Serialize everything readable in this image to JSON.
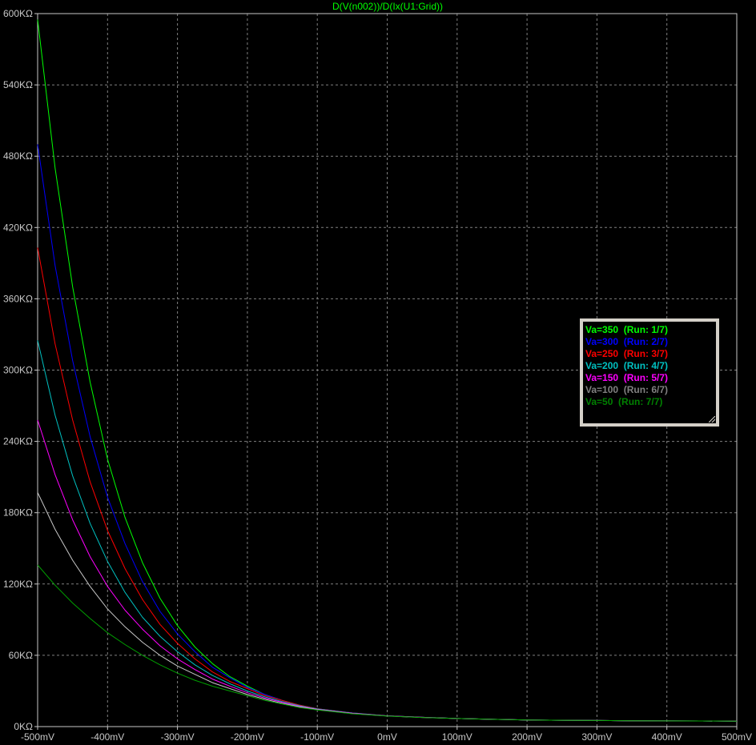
{
  "chart_data": {
    "type": "line",
    "title": "D(V(n002))/D(Ix(U1:Grid))",
    "title_color": "#00ff00",
    "xlabel": "",
    "ylabel": "",
    "x_ticks": [
      "-500mV",
      "-400mV",
      "-300mV",
      "-200mV",
      "-100mV",
      "0mV",
      "100mV",
      "200mV",
      "300mV",
      "400mV",
      "500mV"
    ],
    "y_ticks": [
      "0KΩ",
      "60KΩ",
      "120KΩ",
      "180KΩ",
      "240KΩ",
      "300KΩ",
      "360KΩ",
      "420KΩ",
      "480KΩ",
      "540KΩ",
      "600KΩ"
    ],
    "xlim": [
      -500,
      500
    ],
    "ylim": [
      0,
      600
    ],
    "x_unit": "mV",
    "y_unit": "KΩ",
    "grid": true,
    "legend_placement": "right",
    "x": [
      -500,
      -475,
      -450,
      -425,
      -400,
      -375,
      -350,
      -325,
      -300,
      -275,
      -250,
      -225,
      -200,
      -175,
      -150,
      -125,
      -100,
      -50,
      0,
      50,
      100,
      150,
      200,
      250,
      300,
      350,
      400,
      450,
      500
    ],
    "series": [
      {
        "name": "Va=350",
        "run": "(Run: 1/7)",
        "color": "#00ff00",
        "values": [
          595,
          470,
          370,
          290,
          225,
          176,
          138,
          108,
          85,
          67,
          53,
          42,
          34,
          27,
          22,
          18,
          15,
          11.5,
          9,
          7.8,
          6.8,
          6.1,
          5.6,
          5.3,
          5.1,
          4.9,
          4.8,
          4.7,
          4.6
        ]
      },
      {
        "name": "Va=300",
        "run": "(Run: 2/7)",
        "color": "#0000ff",
        "values": [
          490,
          388,
          308,
          244,
          193,
          154,
          122,
          97,
          78,
          63,
          50,
          41,
          33,
          27,
          22,
          18,
          15,
          11.5,
          9,
          7.8,
          6.8,
          6.1,
          5.6,
          5.3,
          5.1,
          4.9,
          4.8,
          4.7,
          4.6
        ]
      },
      {
        "name": "Va=250",
        "run": "(Run: 3/7)",
        "color": "#ff0000",
        "values": [
          403,
          322,
          258,
          206,
          165,
          133,
          107,
          86,
          70,
          57,
          46,
          38,
          32,
          26,
          22,
          18,
          15,
          11.4,
          9,
          7.8,
          6.8,
          6.1,
          5.6,
          5.3,
          5.1,
          4.9,
          4.8,
          4.7,
          4.6
        ]
      },
      {
        "name": "Va=200",
        "run": "(Run: 4/7)",
        "color": "#00c0c0",
        "values": [
          325,
          262,
          211,
          171,
          139,
          113,
          92,
          76,
          63,
          52,
          43,
          36,
          30,
          25,
          21,
          17.5,
          14.8,
          11.3,
          9,
          7.8,
          6.8,
          6.1,
          5.6,
          5.3,
          5.1,
          4.9,
          4.8,
          4.7,
          4.6
        ]
      },
      {
        "name": "Va=150",
        "run": "(Run: 5/7)",
        "color": "#ff00ff",
        "values": [
          258,
          212,
          174,
          143,
          118,
          98,
          82,
          68,
          57,
          48,
          40,
          34,
          28.5,
          24,
          20.5,
          17,
          14.5,
          11.2,
          9,
          7.8,
          6.8,
          6.1,
          5.6,
          5.3,
          5.1,
          4.9,
          4.8,
          4.7,
          4.6
        ]
      },
      {
        "name": "Va=100",
        "run": "(Run: 6/7)",
        "color": "#c8c8c8",
        "values": [
          197,
          166,
          140,
          118,
          99,
          84,
          71,
          60,
          51,
          44,
          37,
          32,
          27,
          23,
          19.5,
          16.5,
          14.2,
          11,
          8.9,
          7.7,
          6.8,
          6.1,
          5.6,
          5.3,
          5.1,
          4.9,
          4.8,
          4.7,
          4.6
        ]
      },
      {
        "name": "Va=50",
        "run": "(Run: 7/7)",
        "color": "#00a000",
        "values": [
          136,
          119,
          104,
          91,
          79,
          69,
          60,
          52,
          45,
          39,
          34,
          30,
          26,
          22,
          19,
          16,
          14,
          10.8,
          8.8,
          7.7,
          6.8,
          6.1,
          5.6,
          5.3,
          5.1,
          4.9,
          4.8,
          4.7,
          4.6
        ]
      }
    ]
  },
  "legend": {
    "rows": [
      {
        "label": "Va=350  (Run: 1/7)",
        "color": "#00ff00"
      },
      {
        "label": "Va=300  (Run: 2/7)",
        "color": "#0000ff"
      },
      {
        "label": "Va=250  (Run: 3/7)",
        "color": "#ff0000"
      },
      {
        "label": "Va=200  (Run: 4/7)",
        "color": "#00c0c0"
      },
      {
        "label": "Va=150  (Run: 5/7)",
        "color": "#ff00ff"
      },
      {
        "label": "Va=100  (Run: 6/7)",
        "color": "#808080"
      },
      {
        "label": "Va=50  (Run: 7/7)",
        "color": "#008000"
      }
    ]
  },
  "colors": {
    "background": "#000000",
    "grid": "#808080",
    "axis": "#c8c8c8",
    "tick_text": "#c8c8c8"
  }
}
